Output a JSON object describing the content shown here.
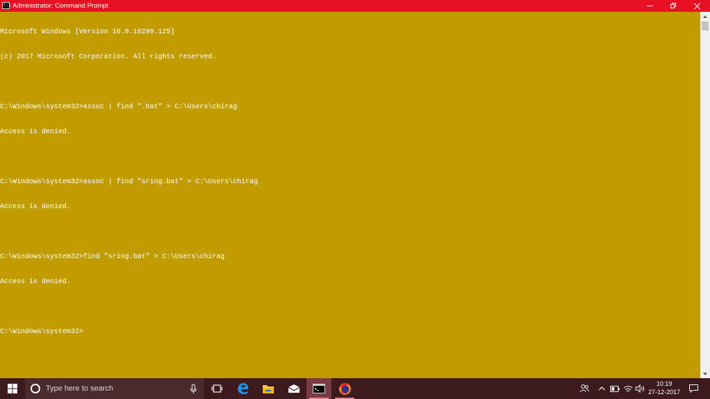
{
  "window": {
    "title": "Administrator: Command Prompt",
    "app_icon_text": "C:\\",
    "controls": [
      "minimize",
      "restore",
      "close"
    ],
    "title_bar_color": "#e81123"
  },
  "console": {
    "background_color": "#c19c00",
    "text_color": "#ffffff",
    "lines": [
      "Microsoft Windows [Version 10.0.16299.125]",
      "(c) 2017 Microsoft Corporation. All rights reserved.",
      "",
      "C:\\Windows\\system32>assoc | find \".bat\" > C:\\Users\\chirag",
      "Access is denied.",
      "",
      "C:\\Windows\\system32>assoc | find \"sring.bat\" > C:\\Users\\chirag",
      "Access is denied.",
      "",
      "C:\\Windows\\system32>find \"sring.bat\" > C:\\Users\\chirag",
      "Access is denied.",
      "",
      "C:\\Windows\\system32>"
    ]
  },
  "taskbar": {
    "background_color": "#3c1a1e",
    "search": {
      "placeholder": "Type here to search"
    },
    "pinned": [
      {
        "name": "task-view",
        "icon": "task-view-icon"
      },
      {
        "name": "edge",
        "icon": "edge-icon"
      },
      {
        "name": "file-explorer",
        "icon": "folder-icon"
      },
      {
        "name": "mail",
        "icon": "mail-icon"
      },
      {
        "name": "command-prompt",
        "icon": "cmd-icon",
        "active": true
      },
      {
        "name": "firefox",
        "icon": "firefox-icon"
      }
    ],
    "tray_icons": [
      "people-icon",
      "chevron-up-icon",
      "battery-icon",
      "wifi-icon",
      "volume-icon"
    ],
    "clock": {
      "time": "10:19",
      "date": "27-12-2017"
    }
  }
}
